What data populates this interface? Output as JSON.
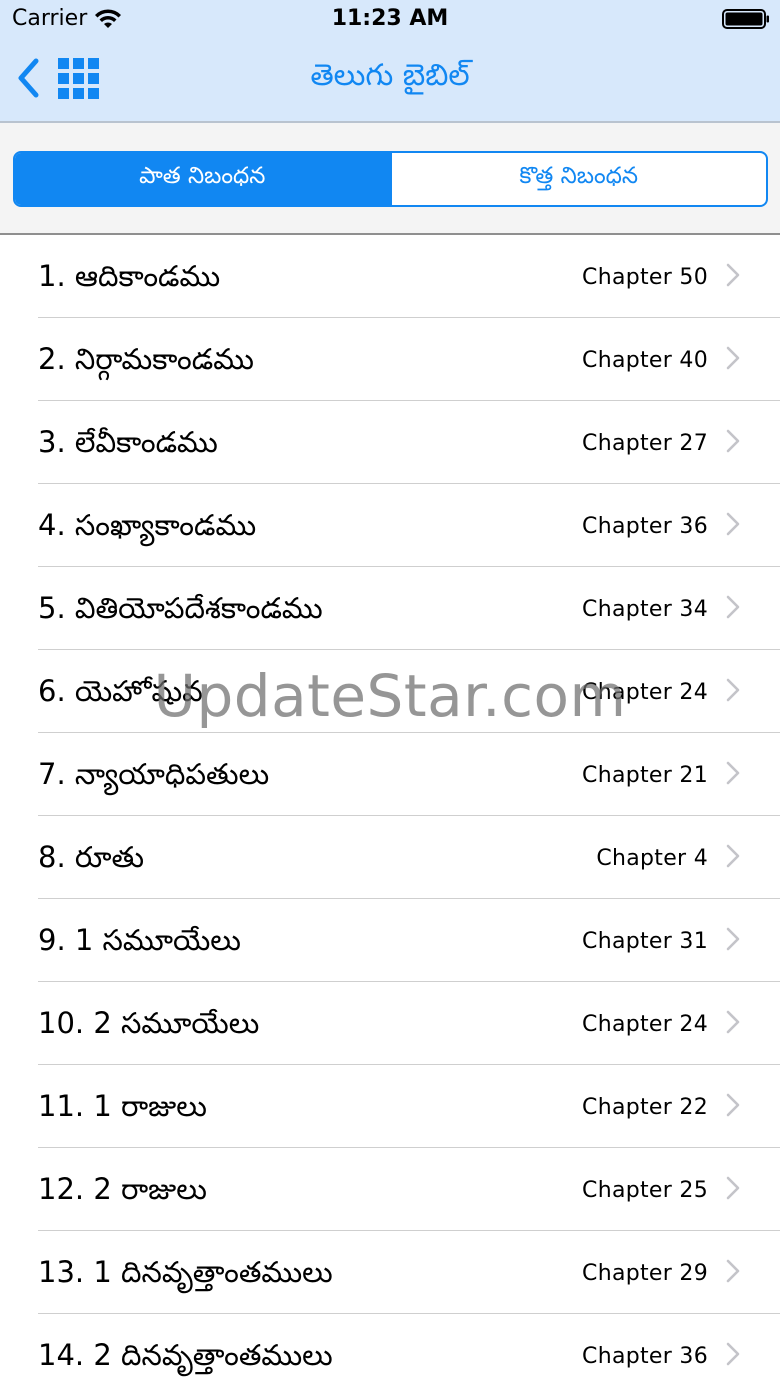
{
  "status_bar": {
    "carrier": "Carrier",
    "time": "11:23 AM",
    "icons": [
      "wifi-icon",
      "battery-icon"
    ]
  },
  "nav_bar": {
    "title": "తెలుగు బైబిల్",
    "back_icon": "chevron-left-icon",
    "grid_icon": "grid-icon"
  },
  "segments": {
    "old_testament": "పాత నిబంధన",
    "new_testament": "కొత్త నిబంధన",
    "selected": "old_testament"
  },
  "books": [
    {
      "title": "1. ఆదికాండము",
      "chapter": "Chapter 50"
    },
    {
      "title": "2. నిర్గామకాండము",
      "chapter": "Chapter 40"
    },
    {
      "title": "3. లేవీకాండము",
      "chapter": "Chapter 27"
    },
    {
      "title": "4. సంఖ్యాకాండము",
      "chapter": "Chapter 36"
    },
    {
      "title": "5. వితియోపదేశకాండము",
      "chapter": "Chapter 34"
    },
    {
      "title": "6. యెహోషువ",
      "chapter": "Chapter 24"
    },
    {
      "title": "7. న్యాయాధిపతులు",
      "chapter": "Chapter 21"
    },
    {
      "title": "8. రూతు",
      "chapter": "Chapter 4"
    },
    {
      "title": "9. 1 సమూయేలు",
      "chapter": "Chapter 31"
    },
    {
      "title": "10. 2 సమూయేలు",
      "chapter": "Chapter 24"
    },
    {
      "title": "11. 1 రాజులు",
      "chapter": "Chapter 22"
    },
    {
      "title": "12. 2 రాజులు",
      "chapter": "Chapter 25"
    },
    {
      "title": "13. 1 దినవృత్తాంతములు",
      "chapter": "Chapter 29"
    },
    {
      "title": "14. 2 దినవృత్తాంతములు",
      "chapter": "Chapter 36"
    }
  ],
  "watermark": "UpdateStar.com",
  "colors": {
    "accent": "#1187f2",
    "nav_background": "#d7e8fb",
    "segment_area_background": "#f4f4f4"
  }
}
